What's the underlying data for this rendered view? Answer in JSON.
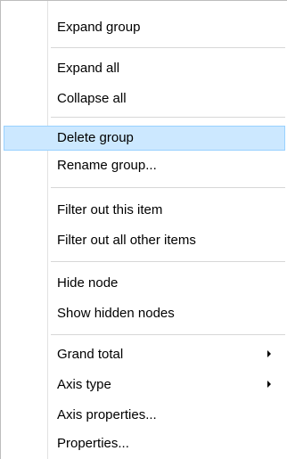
{
  "menu": {
    "expand_group": "Expand group",
    "expand_all": "Expand all",
    "collapse_all": "Collapse all",
    "delete_group": "Delete group",
    "rename_group": "Rename group...",
    "filter_out_item": "Filter out this item",
    "filter_out_others": "Filter out all other items",
    "hide_node": "Hide node",
    "show_hidden_nodes": "Show hidden nodes",
    "grand_total": "Grand total",
    "axis_type": "Axis type",
    "axis_properties": "Axis properties...",
    "properties": "Properties...",
    "highlighted_item": "Delete group",
    "submenu_arrow_icon": "chevron-right-icon",
    "highlight_color": "#cce8ff",
    "highlight_border_color": "#99d1ff"
  }
}
